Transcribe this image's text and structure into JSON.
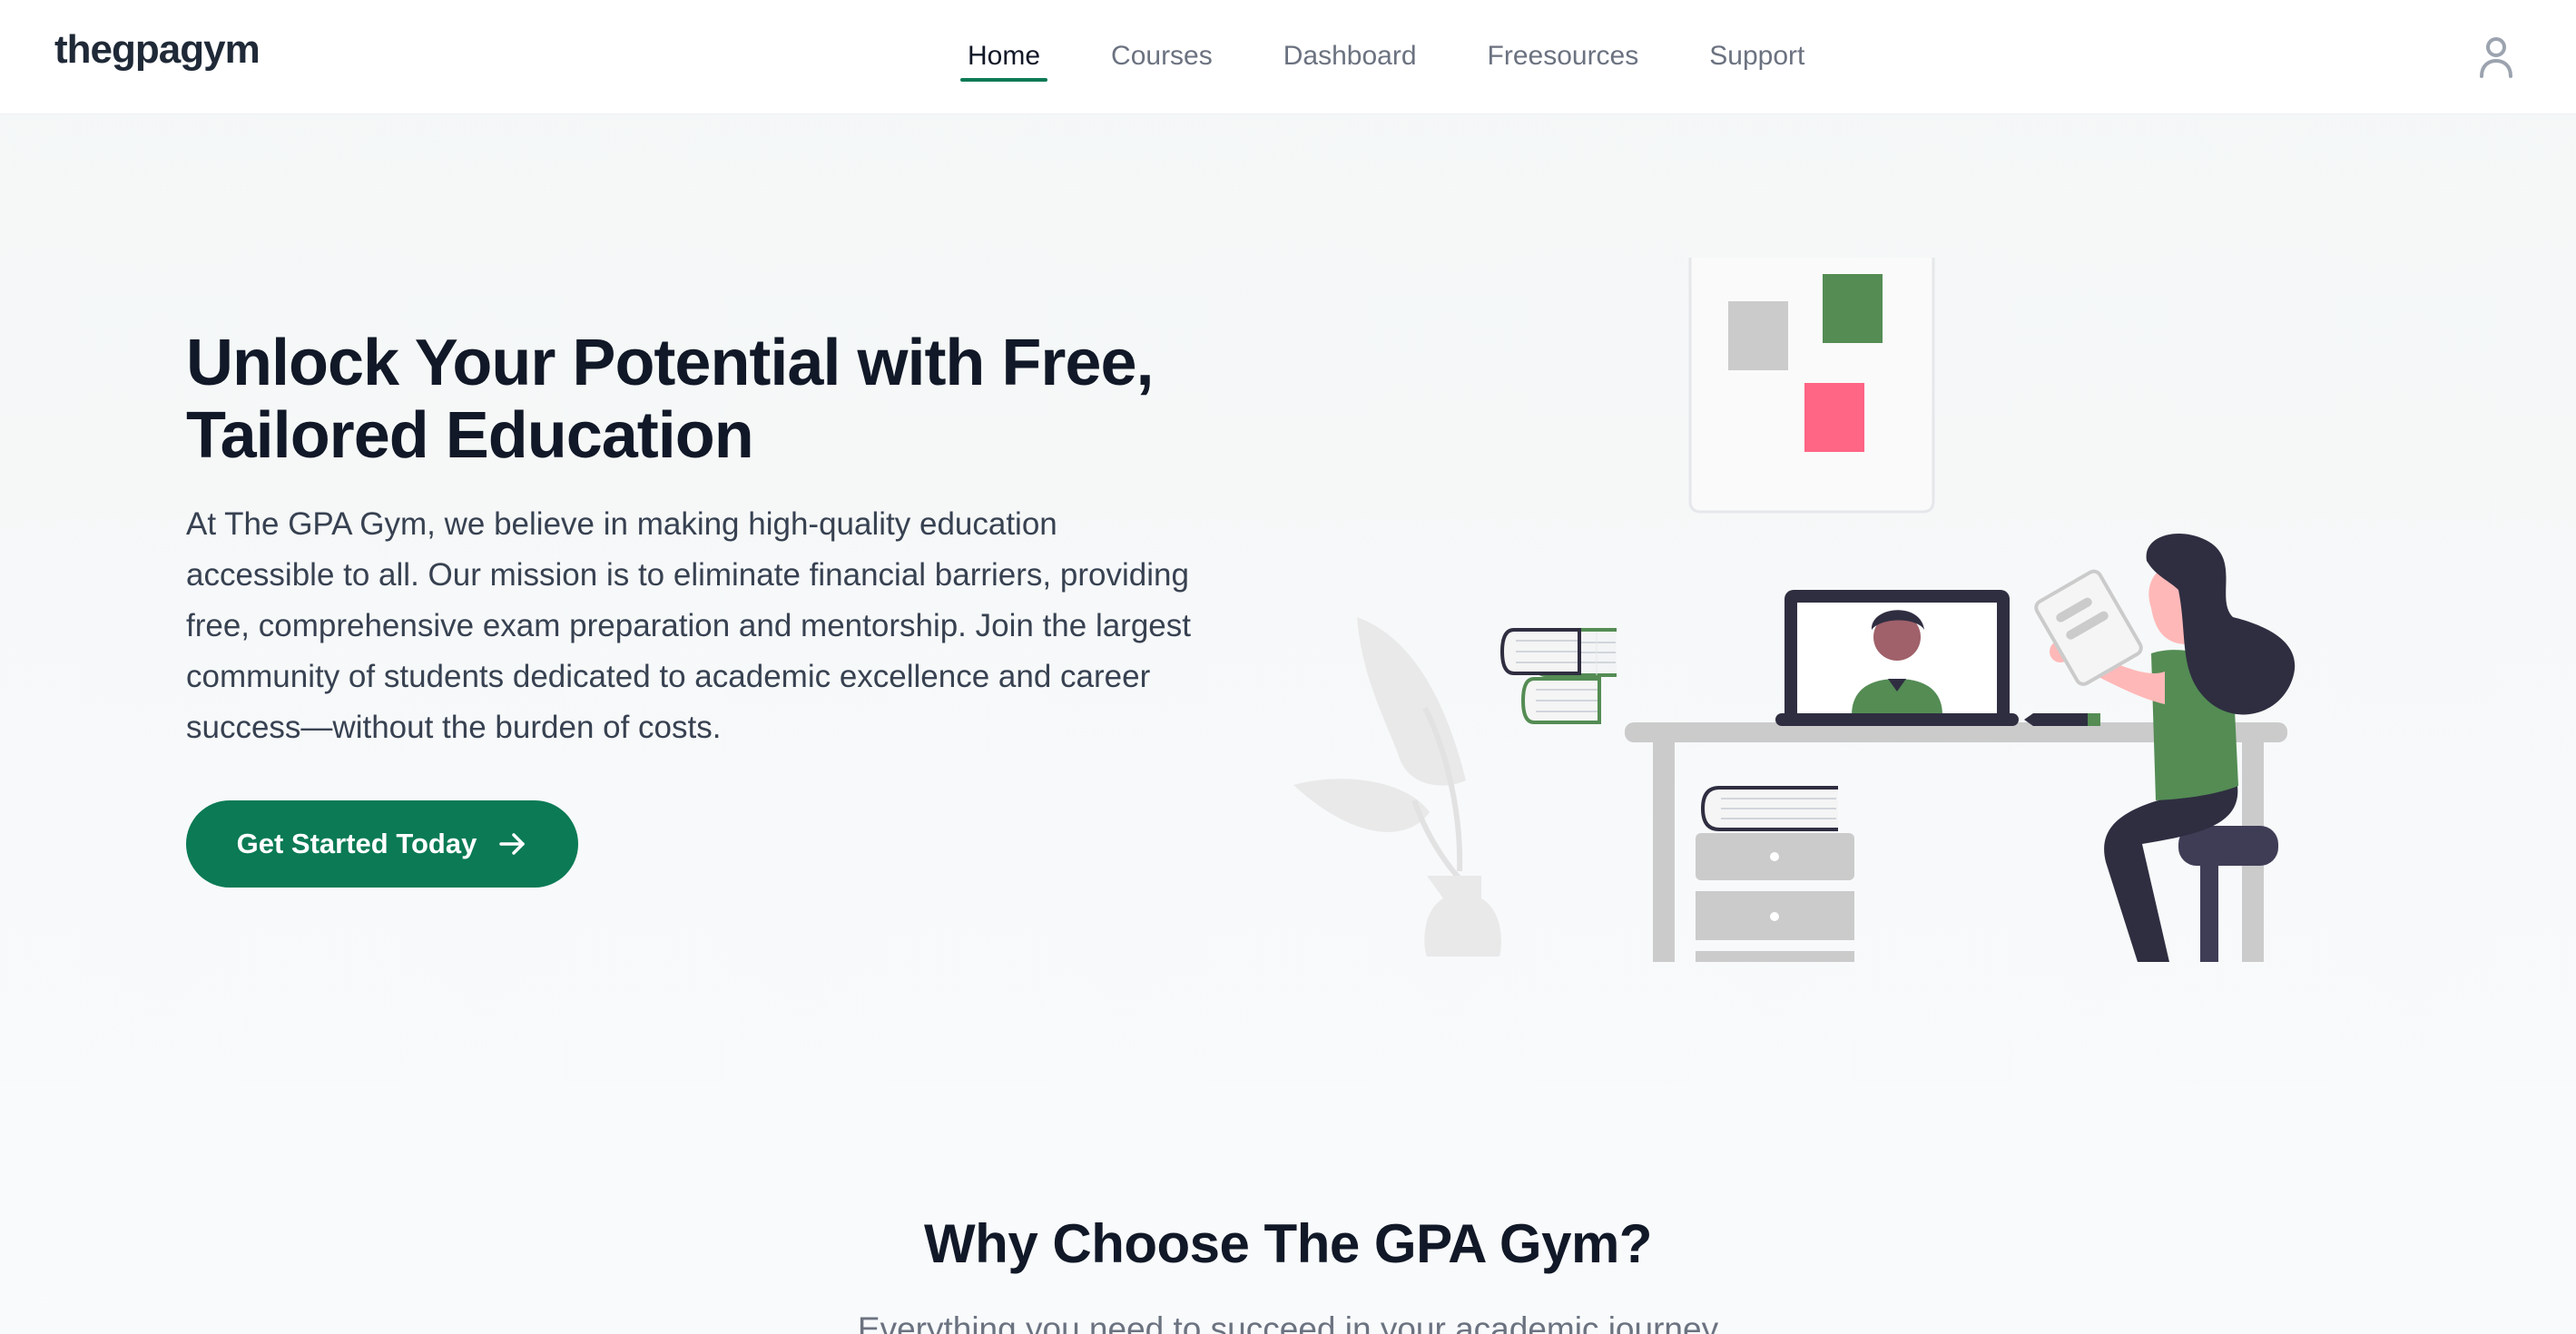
{
  "header": {
    "logo": "thegpagym",
    "nav": [
      {
        "label": "Home",
        "active": true
      },
      {
        "label": "Courses",
        "active": false
      },
      {
        "label": "Dashboard",
        "active": false
      },
      {
        "label": "Freesources",
        "active": false
      },
      {
        "label": "Support",
        "active": false
      }
    ],
    "user_icon": "user-icon"
  },
  "hero": {
    "title_line1": "Unlock Your Potential with Free,",
    "title_line2": "Tailored Education",
    "description": "At The GPA Gym, we believe in making high-quality education accessible to all. Our mission is to eliminate financial barriers, providing free, comprehensive exam preparation and mentorship. Join the largest community of students dedicated to academic excellence and career success—without the burden of costs.",
    "cta_label": "Get Started Today",
    "cta_icon": "arrow-right-icon"
  },
  "why": {
    "title": "Why Choose The GPA Gym?",
    "subtitle": "Everything you need to succeed in your academic journey"
  },
  "colors": {
    "brand": "#0b7a55",
    "illustration_green": "#548c54",
    "illustration_pink": "#ff6584",
    "illustration_dark": "#2f2e41"
  }
}
